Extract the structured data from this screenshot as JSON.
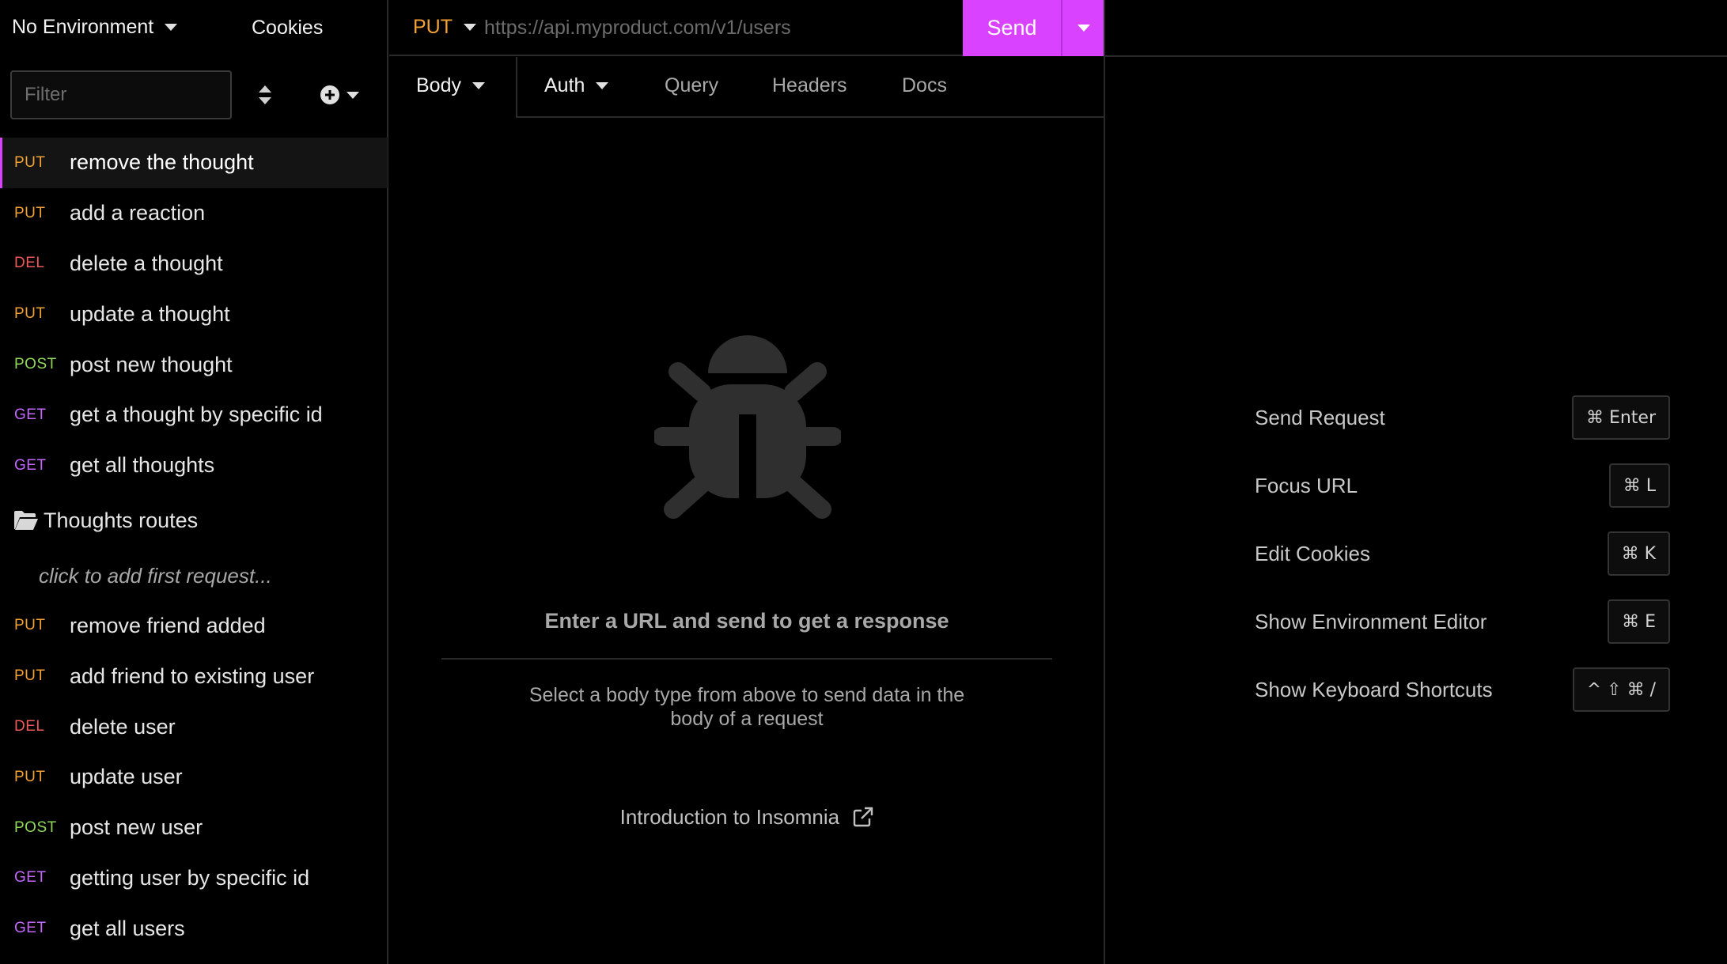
{
  "sidebar": {
    "environment": "No Environment",
    "cookies": "Cookies",
    "filter_placeholder": "Filter",
    "requests": [
      {
        "method": "PUT",
        "name": "remove the thought",
        "active": true
      },
      {
        "method": "PUT",
        "name": "add a reaction"
      },
      {
        "method": "DEL",
        "name": "delete a thought"
      },
      {
        "method": "PUT",
        "name": "update a thought"
      },
      {
        "method": "POST",
        "name": "post new thought"
      },
      {
        "method": "GET",
        "name": "get a thought by specific id"
      },
      {
        "method": "GET",
        "name": "get all thoughts"
      }
    ],
    "folder": {
      "name": "Thoughts routes",
      "empty_hint": "click to add first request..."
    },
    "requests2": [
      {
        "method": "PUT",
        "name": "remove friend added"
      },
      {
        "method": "PUT",
        "name": "add friend to existing user"
      },
      {
        "method": "DEL",
        "name": "delete user"
      },
      {
        "method": "PUT",
        "name": "update user"
      },
      {
        "method": "POST",
        "name": "post new user"
      },
      {
        "method": "GET",
        "name": "getting user by specific id"
      },
      {
        "method": "GET",
        "name": "get all users"
      }
    ]
  },
  "request": {
    "method": "PUT",
    "url_placeholder": "https://api.myproduct.com/v1/users",
    "send_label": "Send",
    "tabs": {
      "body": "Body",
      "auth": "Auth",
      "query": "Query",
      "headers": "Headers",
      "docs": "Docs"
    },
    "empty": {
      "title": "Enter a URL and send to get a response",
      "description": "Select a body type from above to send data in the body of a request",
      "intro_link": "Introduction to Insomnia"
    }
  },
  "shortcuts": [
    {
      "label": "Send Request",
      "keys": "⌘ Enter"
    },
    {
      "label": "Focus URL",
      "keys": "⌘ L"
    },
    {
      "label": "Edit Cookies",
      "keys": "⌘ K"
    },
    {
      "label": "Show Environment Editor",
      "keys": "⌘ E"
    },
    {
      "label": "Show Keyboard Shortcuts",
      "keys": "^ ⇧ ⌘ /"
    }
  ],
  "colors": {
    "accent": "#d943ff",
    "put": "#f2a234",
    "del": "#ef5a5a",
    "post": "#8fd85a",
    "get": "#c467ff"
  }
}
